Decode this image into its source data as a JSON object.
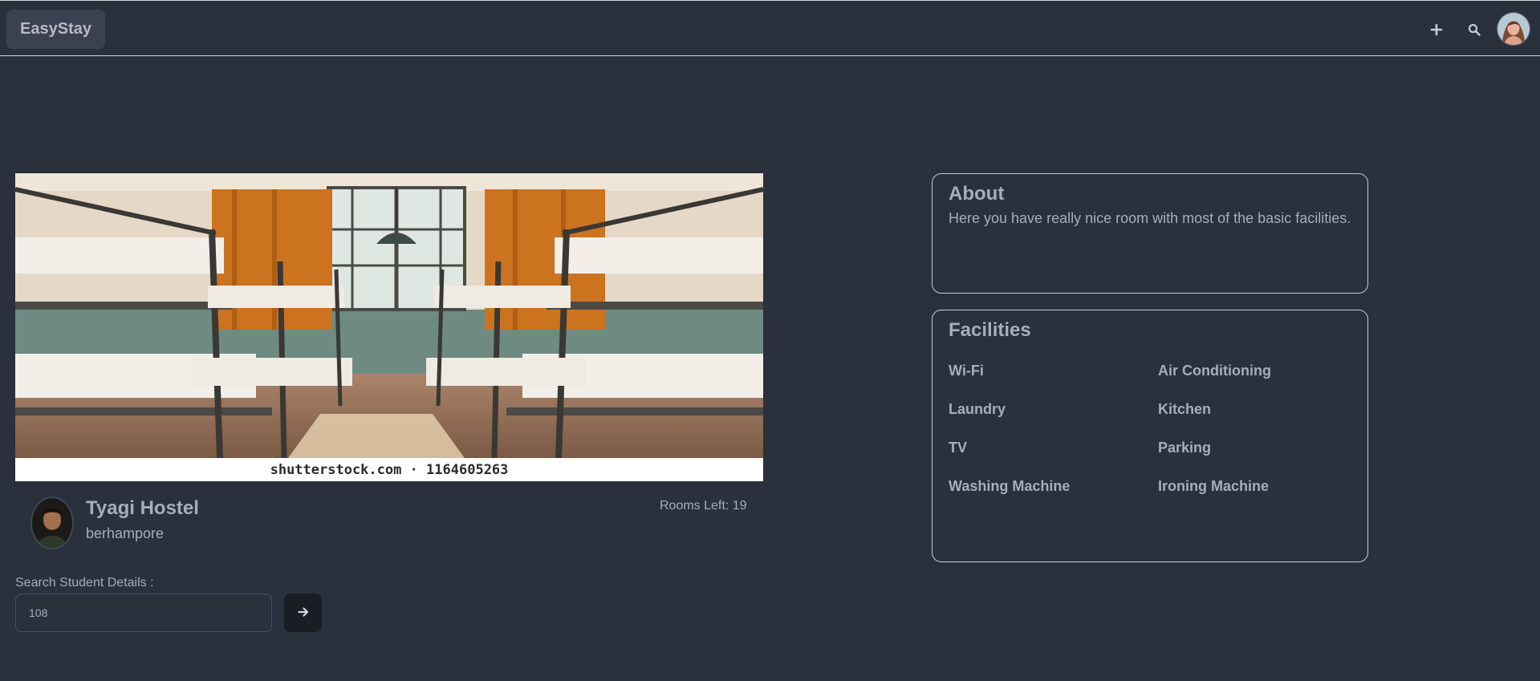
{
  "navbar": {
    "brand": "EasyStay",
    "icons": [
      "plus-icon",
      "search-icon",
      "user-avatar"
    ]
  },
  "hostel": {
    "image_watermark": "shutterstock.com · 1164605263",
    "name": "Tyagi Hostel",
    "city": "berhampore",
    "rooms_left": "Rooms Left: 19"
  },
  "search": {
    "label": "Search Student Details :",
    "value": "108",
    "button_icon": "arrow-right-icon"
  },
  "about": {
    "title": "About",
    "text": "Here you have really nice room with most of the basic facilities."
  },
  "facilities": {
    "title": "Facilities",
    "items": [
      "Wi-Fi",
      "Air Conditioning",
      "Laundry",
      "Kitchen",
      "TV",
      "Parking",
      "Washing Machine",
      "Ironing Machine"
    ]
  },
  "colors": {
    "background": "#2a303c",
    "text": "#a6adbb",
    "button_dark": "#191d24",
    "card_border": "#c9ccd2"
  }
}
